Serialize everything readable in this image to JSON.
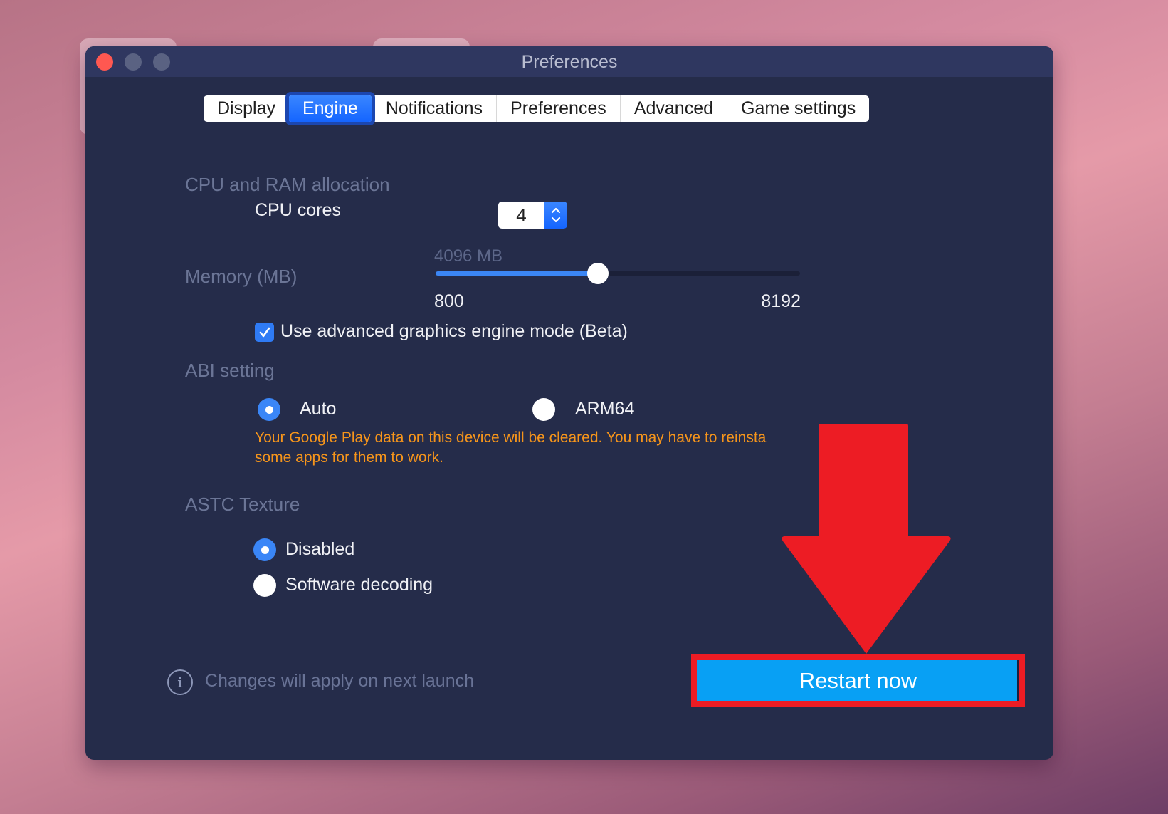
{
  "window": {
    "title": "Preferences"
  },
  "tabs": [
    {
      "label": "Display",
      "active": false
    },
    {
      "label": "Engine",
      "active": true
    },
    {
      "label": "Notifications",
      "active": false
    },
    {
      "label": "Preferences",
      "active": false
    },
    {
      "label": "Advanced",
      "active": false
    },
    {
      "label": "Game settings",
      "active": false
    }
  ],
  "engine": {
    "cpu_ram_section": "CPU and RAM allocation",
    "cpu_cores_label": "CPU cores",
    "cpu_cores_value": "4",
    "memory_label": "Memory (MB)",
    "memory_value_label": "4096 MB",
    "memory": {
      "min": 800,
      "max": 8192,
      "value": 4096
    },
    "memory_min_label": "800",
    "memory_max_label": "8192",
    "advanced_graphics_label": "Use advanced graphics engine mode (Beta)",
    "advanced_graphics_checked": true,
    "abi_section": "ABI setting",
    "abi_options": [
      {
        "label": "Auto",
        "selected": true
      },
      {
        "label": "ARM64",
        "selected": false
      }
    ],
    "abi_warning_line1": "Your Google Play data on this device will be cleared. You may have to reinsta",
    "abi_warning_line2": "some apps for them to work.",
    "astc_section": "ASTC Texture",
    "astc_options": [
      {
        "label": "Disabled",
        "selected": true
      },
      {
        "label": "Software decoding",
        "selected": false
      }
    ]
  },
  "footer": {
    "info_icon": "info-icon",
    "note": "Changes will apply on next launch",
    "restart_label": "Restart now"
  },
  "annotation": {
    "arrow_color": "#ed1c24",
    "highlight_color": "#ed1c24"
  },
  "colors": {
    "accent": "#3a86ff",
    "warning": "#f6951b",
    "button": "#08a0f4",
    "window_bg": "#252c4a"
  }
}
